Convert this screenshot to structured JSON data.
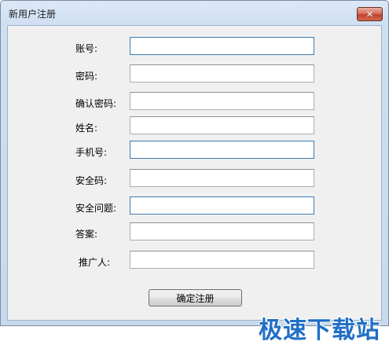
{
  "window": {
    "title": "新用户注册",
    "close_symbol": "✕"
  },
  "form": {
    "fields": [
      {
        "label": "账号:",
        "value": ""
      },
      {
        "label": "密码:",
        "value": ""
      },
      {
        "label": "确认密码:",
        "value": ""
      },
      {
        "label": "姓名:",
        "value": ""
      },
      {
        "label": "手机号:",
        "value": ""
      },
      {
        "label": "安全码:",
        "value": ""
      },
      {
        "label": "安全问题:",
        "value": ""
      },
      {
        "label": "答案:",
        "value": ""
      },
      {
        "label": "推广人:",
        "value": ""
      }
    ],
    "submit_label": "确定注册"
  },
  "watermark": {
    "text": "极速下载站"
  },
  "colors": {
    "watermark": "#1f6fc5",
    "close_button": "#c0432e"
  }
}
